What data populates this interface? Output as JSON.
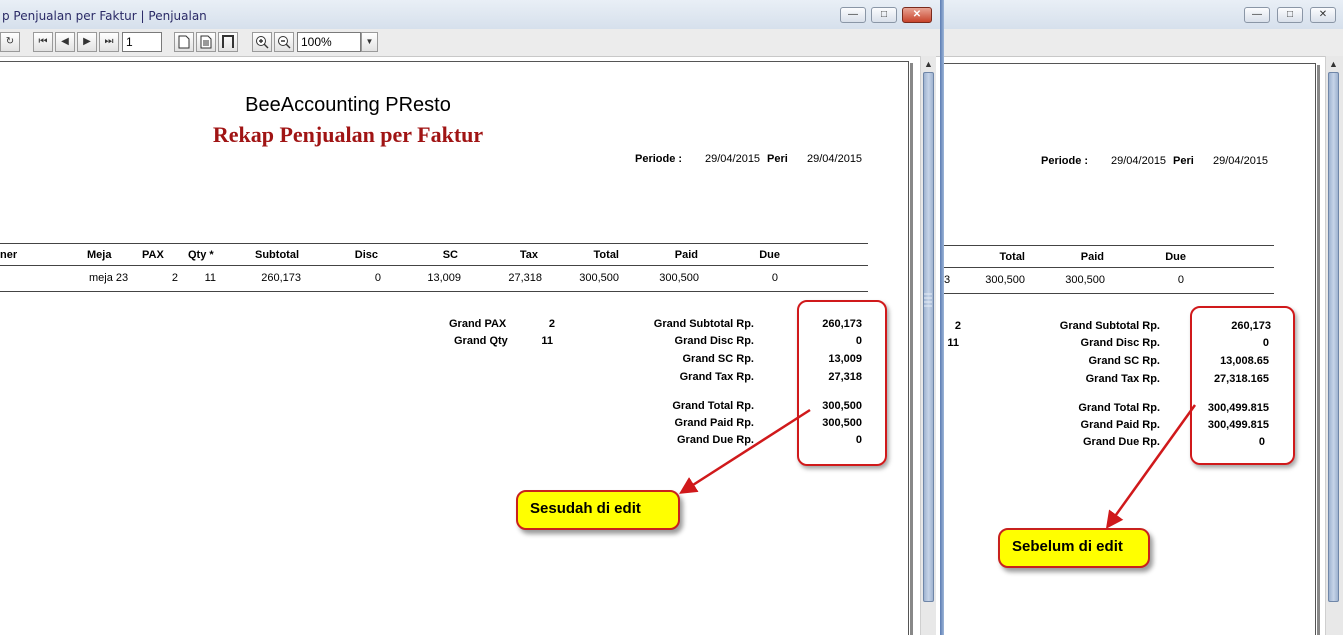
{
  "windowA": {
    "title": "p Penjualan per Faktur | Penjualan",
    "controls": {
      "minimize": "—",
      "maximize": "□",
      "close": "✕"
    },
    "toolbar": {
      "refresh": "↻",
      "first": "⏮",
      "prev": "◀",
      "next": "▶",
      "last": "⏭",
      "page": "1",
      "zoom": "100%",
      "zoom_arrow": "▼"
    },
    "report": {
      "company": "BeeAccounting PResto",
      "title": "Rekap Penjualan per Faktur",
      "periode_label": "Periode :",
      "periode_from": "29/04/2015",
      "periode_sep": "Peri",
      "periode_to": "29/04/2015",
      "columns": [
        "ner",
        "Meja",
        "PAX",
        "Qty *",
        "Subtotal",
        "Disc",
        "SC",
        "Tax",
        "Total",
        "Paid",
        "Due"
      ],
      "row": [
        "meja 23",
        "2",
        "11",
        "260,173",
        "0",
        "13,009",
        "27,318",
        "300,500",
        "300,500",
        "0"
      ],
      "grand_pax_label": "Grand PAX",
      "grand_pax": "2",
      "grand_qty_label": "Grand Qty",
      "grand_qty": "11",
      "totals": [
        {
          "label": "Grand Subtotal Rp.",
          "value": "260,173"
        },
        {
          "label": "Grand Disc Rp.",
          "value": "0"
        },
        {
          "label": "Grand SC Rp.",
          "value": "13,009"
        },
        {
          "label": "Grand Tax Rp.",
          "value": "27,318"
        },
        {
          "label": "Grand Total Rp.",
          "value": "300,500"
        },
        {
          "label": "Grand Paid Rp.",
          "value": "300,500"
        },
        {
          "label": "Grand Due Rp.",
          "value": "0"
        }
      ]
    },
    "callout": "Sesudah di edit"
  },
  "windowB": {
    "controls": {
      "minimize": "—",
      "maximize": "□",
      "close": "✕"
    },
    "report": {
      "periode_label": "Periode :",
      "periode_from": "29/04/2015",
      "periode_sep": "Peri",
      "periode_to": "29/04/2015",
      "columns": [
        "Total",
        "Paid",
        "Due"
      ],
      "row": [
        "3",
        "300,500",
        "300,500",
        "0"
      ],
      "grand_pax": "2",
      "grand_qty": "11",
      "totals": [
        {
          "label": "Grand Subtotal Rp.",
          "value": "260,173"
        },
        {
          "label": "Grand Disc Rp.",
          "value": "0"
        },
        {
          "label": "Grand SC Rp.",
          "value": "13,008.65"
        },
        {
          "label": "Grand Tax Rp.",
          "value": "27,318.165"
        },
        {
          "label": "Grand Total Rp.",
          "value": "300,499.815"
        },
        {
          "label": "Grand Paid Rp.",
          "value": "300,499.815"
        },
        {
          "label": "Grand Due Rp.",
          "value": "0"
        }
      ]
    },
    "callout": "Sebelum di edit"
  },
  "colors": {
    "report_title": "#a01414",
    "callout_fill": "#ffff00",
    "highlight": "#d0191b",
    "window_border": "#6f8fc4"
  }
}
